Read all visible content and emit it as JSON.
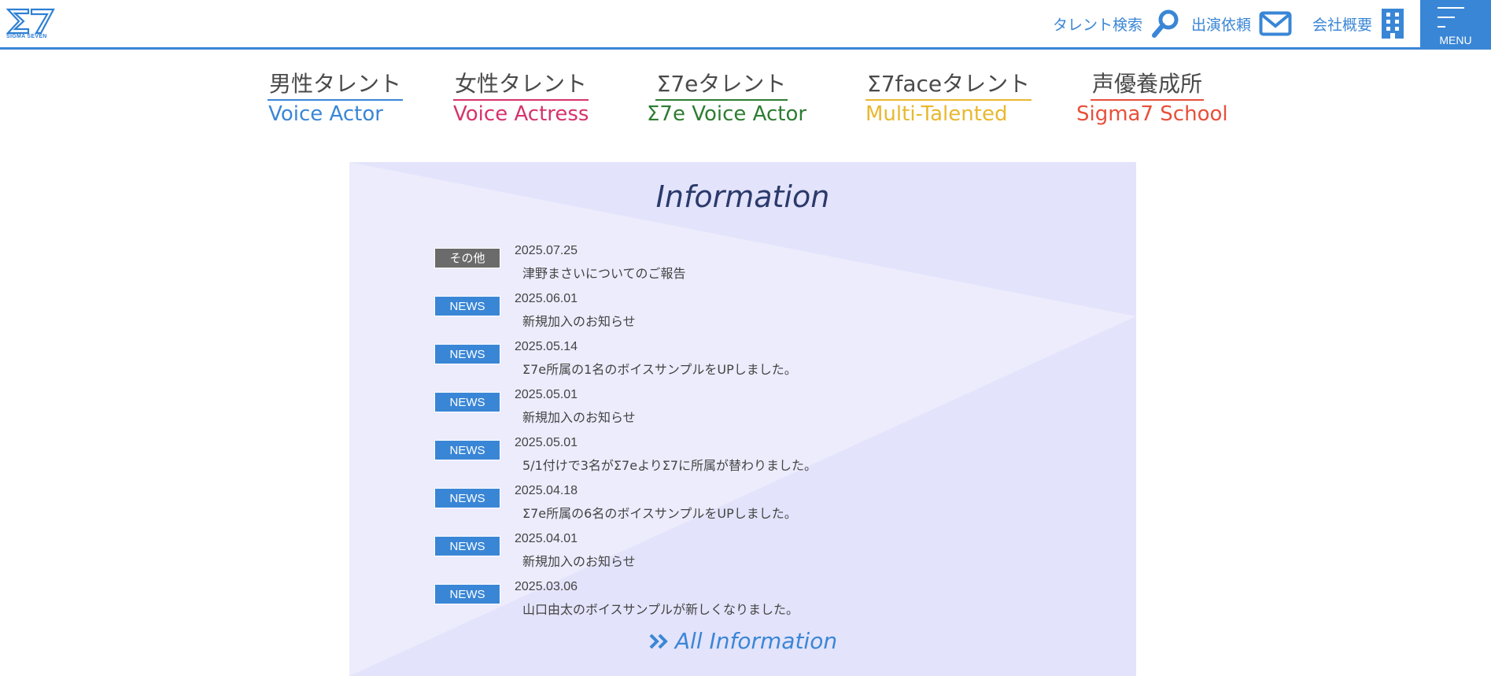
{
  "header": {
    "logo_text": "Σ7",
    "logo_sub": "SIGMA SEVEN",
    "nav": [
      {
        "label": "タレント検索",
        "icon": "search-icon"
      },
      {
        "label": "出演依頼",
        "icon": "mail-icon"
      },
      {
        "label": "会社概要",
        "icon": "building-icon"
      }
    ],
    "menu_label": "MENU",
    "accent": "#3a86d6"
  },
  "categories": [
    {
      "jp": "男性タレント",
      "en": "Voice Actor",
      "color": "#3a86d6"
    },
    {
      "jp": "女性タレント",
      "en": "Voice Actress",
      "color": "#d6336c"
    },
    {
      "jp": "Σ7eタレント",
      "en": "Σ7e Voice Actor",
      "color": "#2e7d32"
    },
    {
      "jp": "Σ7faceタレント",
      "en": "Multi-Talented",
      "color": "#e8b830"
    },
    {
      "jp": "声優養成所",
      "en": "Sigma7 School",
      "color": "#e8503a"
    }
  ],
  "information": {
    "title": "Information",
    "items": [
      {
        "badge": "その他",
        "type": "other",
        "date": "2025.07.25",
        "title": "津野まさいについてのご報告"
      },
      {
        "badge": "NEWS",
        "type": "news",
        "date": "2025.06.01",
        "title": "新規加入のお知らせ"
      },
      {
        "badge": "NEWS",
        "type": "news",
        "date": "2025.05.14",
        "title": "Σ7e所属の1名のボイスサンプルをUPしました。"
      },
      {
        "badge": "NEWS",
        "type": "news",
        "date": "2025.05.01",
        "title": "新規加入のお知らせ"
      },
      {
        "badge": "NEWS",
        "type": "news",
        "date": "2025.05.01",
        "title": "5/1付けで3名がΣ7eよりΣ7に所属が替わりました。"
      },
      {
        "badge": "NEWS",
        "type": "news",
        "date": "2025.04.18",
        "title": "Σ7e所属の6名のボイスサンプルをUPしました。"
      },
      {
        "badge": "NEWS",
        "type": "news",
        "date": "2025.04.01",
        "title": "新規加入のお知らせ"
      },
      {
        "badge": "NEWS",
        "type": "news",
        "date": "2025.03.06",
        "title": "山口由太のボイスサンプルが新しくなりました。"
      }
    ],
    "all_link": "All Information"
  }
}
